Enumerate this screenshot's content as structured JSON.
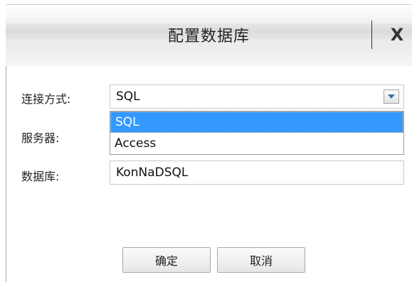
{
  "dialog": {
    "title": "配置数据库",
    "close_label": "X"
  },
  "form": {
    "connection_label": "连接方式:",
    "connection_value": "SQL",
    "server_label": "服务器:",
    "database_label": "数据库:",
    "database_value": "KonNaDSQL"
  },
  "dropdown": {
    "options": [
      "SQL",
      "Access"
    ],
    "selected": "SQL"
  },
  "buttons": {
    "ok_label": "确定",
    "cancel_label": "取消"
  },
  "colors": {
    "selection": "#3399ff",
    "title_text": "#222222"
  },
  "icons": {
    "dropdown_arrow": "chevron-down-icon"
  }
}
